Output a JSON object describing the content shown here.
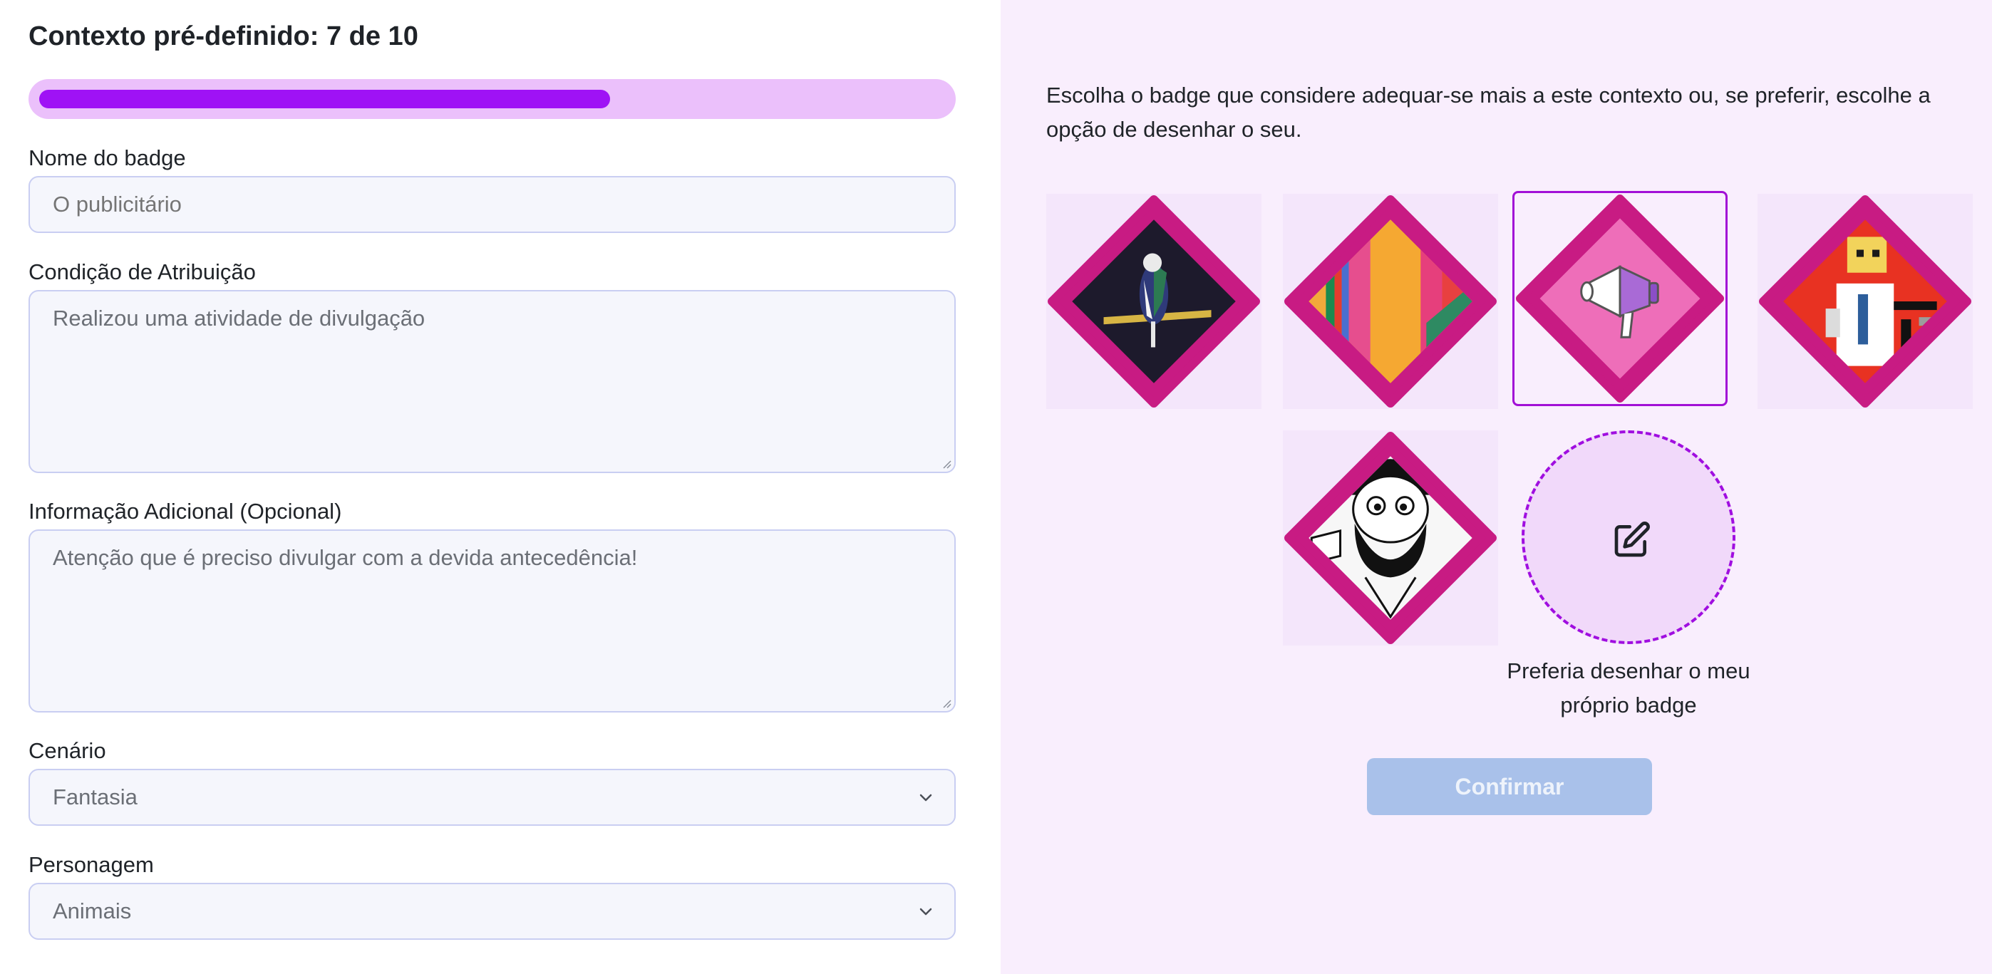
{
  "form": {
    "title": "Contexto pré-definido: 7 de 10",
    "progress_fraction": 0.7,
    "badge_name": {
      "label": "Nome do badge",
      "placeholder": "O publicitário"
    },
    "attribution": {
      "label": "Condição de Atribuição",
      "placeholder": "Realizou uma atividade de divulgação"
    },
    "additional_info": {
      "label": "Informação Adicional (Opcional)",
      "placeholder": "Atenção que é preciso divulgar com a devida antecedência!"
    },
    "scenario": {
      "label": "Cenário",
      "value": "Fantasia"
    },
    "character": {
      "label": "Personagem",
      "value": "Animais"
    }
  },
  "picker": {
    "instructions": "Escolha o badge que considere adequar-se mais a este contexto ou, se preferir, escolhe a opção de desenhar o seu.",
    "badges": [
      {
        "icon": "bird-on-branch-badge",
        "selected": false
      },
      {
        "icon": "colorful-stripes-badge",
        "selected": false
      },
      {
        "icon": "megaphone-badge",
        "selected": true
      },
      {
        "icon": "pixel-character-badge",
        "selected": false
      },
      {
        "icon": "bearded-man-badge",
        "selected": false
      }
    ],
    "draw_own_label": "Preferia desenhar o meu próprio badge",
    "draw_icon": "edit-icon",
    "confirm_label": "Confirmar"
  },
  "colors": {
    "accent": "#9f12f5",
    "badge_frame": "#c81b83",
    "panel_background": "#f9eefd",
    "confirm_disabled": "#a9c1ea"
  }
}
